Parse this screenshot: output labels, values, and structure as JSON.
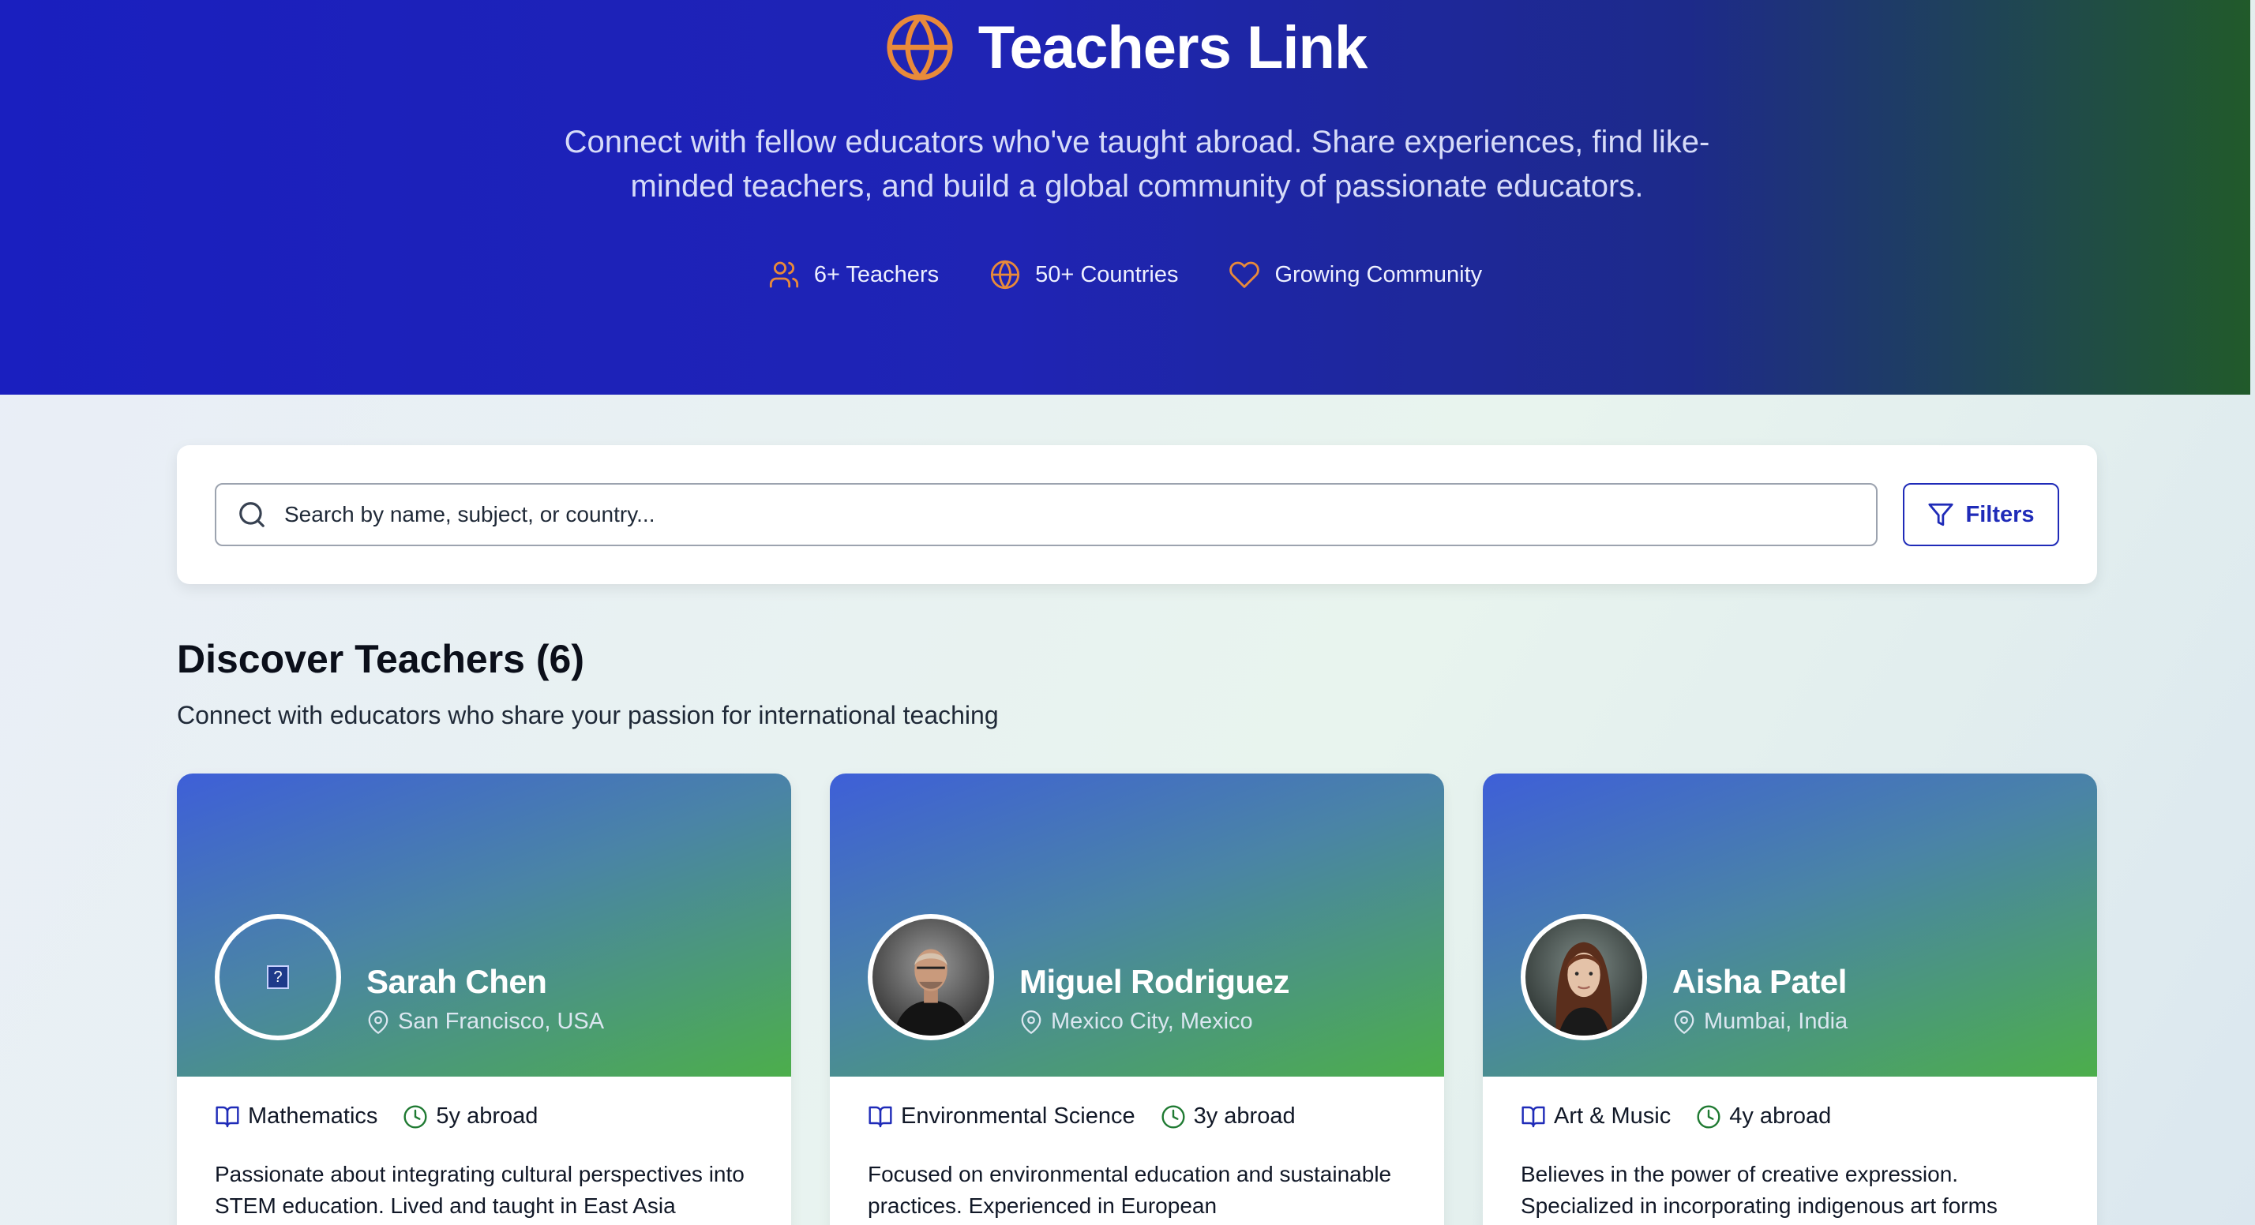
{
  "hero": {
    "title": "Teachers Link",
    "subtitle": "Connect with fellow educators who've taught abroad. Share experiences, find like-minded teachers, and build a global community of passionate educators.",
    "stats": [
      {
        "icon": "users-icon",
        "label": "6+ Teachers"
      },
      {
        "icon": "globe-icon",
        "label": "50+ Countries"
      },
      {
        "icon": "heart-icon",
        "label": "Growing Community"
      }
    ]
  },
  "search": {
    "placeholder": "Search by name, subject, or country...",
    "value": "",
    "filters_label": "Filters"
  },
  "section": {
    "title": "Discover Teachers (6)",
    "subtitle": "Connect with educators who share your passion for international teaching"
  },
  "teachers": [
    {
      "name": "Sarah Chen",
      "location": "San Francisco, USA",
      "subject": "Mathematics",
      "abroad": "5y abroad",
      "bio": "Passionate about integrating cultural perspectives into STEM education. Lived and taught in East Asia"
    },
    {
      "name": "Miguel Rodriguez",
      "location": "Mexico City, Mexico",
      "subject": "Environmental Science",
      "abroad": "3y abroad",
      "bio": "Focused on environmental education and sustainable practices. Experienced in European"
    },
    {
      "name": "Aisha Patel",
      "location": "Mumbai, India",
      "subject": "Art & Music",
      "abroad": "4y abroad",
      "bio": "Believes in the power of creative expression. Specialized in incorporating indigenous art forms"
    }
  ],
  "colors": {
    "accent": "#1f2bb8",
    "icon_orange": "#e88a3a",
    "icon_green": "#1f7a32"
  }
}
